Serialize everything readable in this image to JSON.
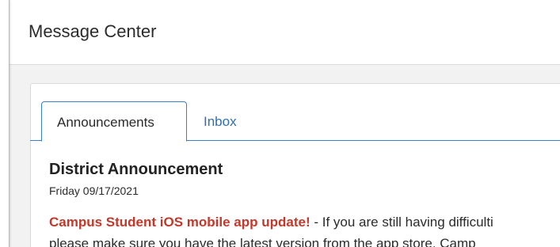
{
  "header": {
    "title": "Message Center"
  },
  "tabs": [
    {
      "label": "Announcements",
      "active": true
    },
    {
      "label": "Inbox",
      "active": false
    }
  ],
  "announcement": {
    "title": "District Announcement",
    "date": "Friday 09/17/2021",
    "highlight": "Campus Student iOS mobile app update!",
    "body_line1_rest": " - If you are still having difficulti",
    "body_line2": "please make sure you have the latest version from the app store.  Camp"
  },
  "colors": {
    "accent": "#3b7fc4",
    "link": "#2f6fb3",
    "highlight": "#c0392b"
  }
}
